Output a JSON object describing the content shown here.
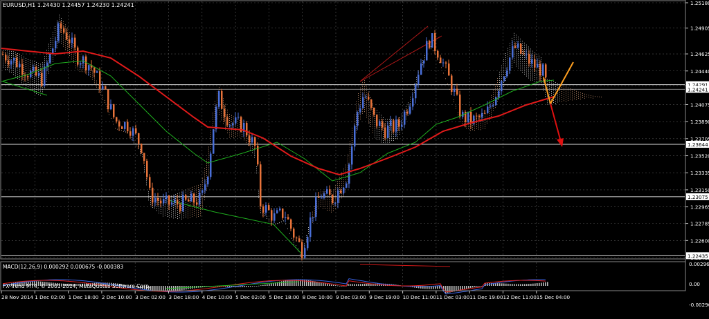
{
  "symbol_header": "EURUSD,H1  1.24430 1.24457 1.24230 1.24241",
  "macd_header": "MACD(12,26,9) 0.000292 0.000675 -0.000383",
  "copyright": "FX-Trend MT4, © 2001-2014, MetaQuotes Software Corp.",
  "colors": {
    "background": "#000000",
    "grid": "#555555",
    "axis_text": "#ffffff",
    "bull_candle": "#4a6fd8",
    "bear_candle": "#e8733a",
    "ma_red": "#e01a1a",
    "ma_green": "#1fae1f",
    "cloud_white": "#e8e8e8",
    "cloud_tan": "#d9a07a",
    "arrow_orange": "#ffa020",
    "arrow_red": "#e01010",
    "price_box_bg": "#ffffff",
    "price_box_text": "#000000"
  },
  "price_axis": {
    "labels": [
      "1.25180",
      "1.24905",
      "1.24625",
      "1.24440",
      "1.24280",
      "1.24075",
      "1.23890",
      "1.23705",
      "1.23520",
      "1.23335",
      "1.23150",
      "1.22965",
      "1.22785",
      "1.22600",
      "1.22415"
    ],
    "boxed_labels": [
      "1.24291",
      "1.23644",
      "1.23075",
      "1.22435"
    ],
    "current_price": "1.24241"
  },
  "macd_axis": {
    "labels": [
      "0.002962",
      "0.00",
      "-0.002905"
    ]
  },
  "time_axis": {
    "labels": [
      "28 Nov 2014",
      "1 Dec 02:00",
      "1 Dec 18:00",
      "2 Dec 10:00",
      "3 Dec 02:00",
      "3 Dec 18:00",
      "4 Dec 10:00",
      "5 Dec 02:00",
      "5 Dec 18:00",
      "8 Dec 10:00",
      "9 Dec 03:00",
      "9 Dec 19:00",
      "10 Dec 11:00",
      "11 Dec 03:00",
      "11 Dec 19:00",
      "12 Dec 11:00",
      "15 Dec 04:00"
    ]
  }
}
